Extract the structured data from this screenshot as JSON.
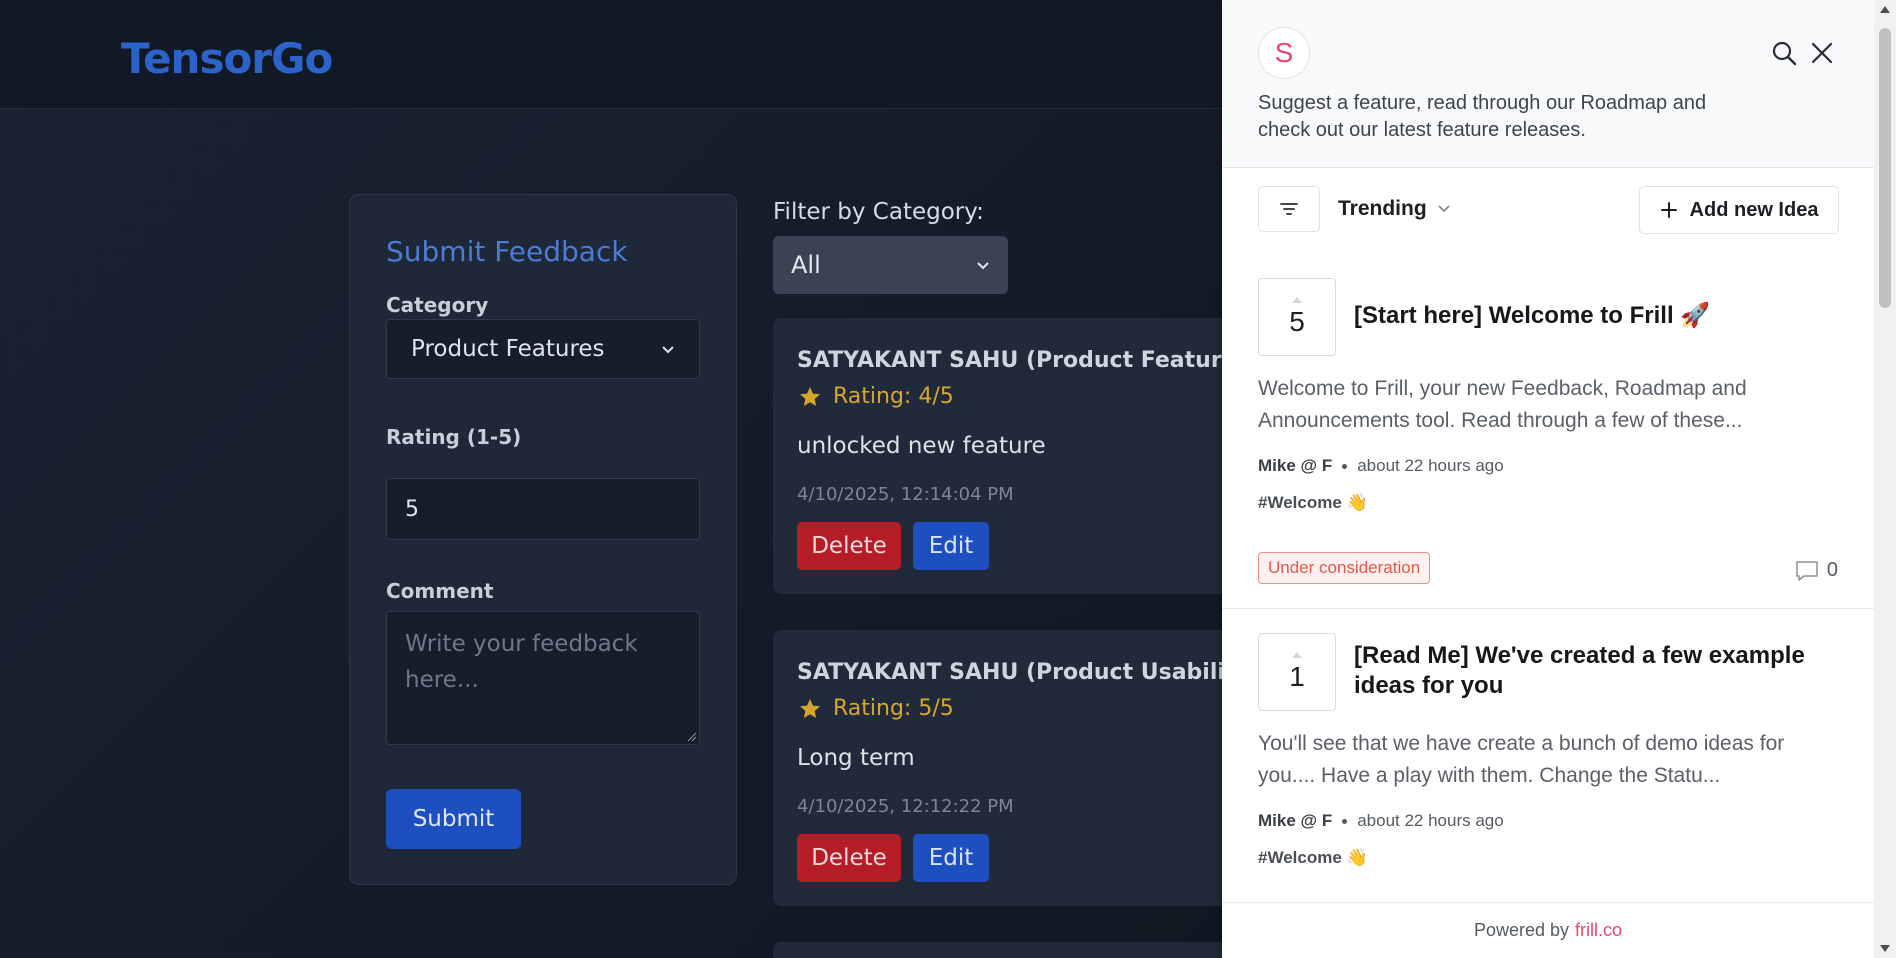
{
  "app": {
    "logo": "TensorGo"
  },
  "form": {
    "title": "Submit Feedback",
    "category_label": "Category",
    "category_value": "Product Features",
    "rating_label": "Rating (1-5)",
    "rating_value": "5",
    "comment_label": "Comment",
    "comment_placeholder": "Write your feedback here...",
    "submit_label": "Submit"
  },
  "filter": {
    "label": "Filter by Category:",
    "value": "All"
  },
  "feedback": [
    {
      "name": "SATYAKANT SAHU (Product Features)",
      "rating": "Rating: 4/5",
      "comment": "unlocked new feature",
      "date": "4/10/2025, 12:14:04 PM",
      "delete_label": "Delete",
      "edit_label": "Edit"
    },
    {
      "name": "SATYAKANT SAHU (Product Usability)",
      "rating": "Rating: 5/5",
      "comment": "Long term",
      "date": "4/10/2025, 12:12:22 PM",
      "delete_label": "Delete",
      "edit_label": "Edit"
    }
  ],
  "frill": {
    "avatar_letter": "S",
    "description": "Suggest a feature, read through our Roadmap and check out our latest feature releases.",
    "sort_label": "Trending",
    "add_idea_label": "Add new Idea",
    "ideas": [
      {
        "votes": "5",
        "title": "[Start here] Welcome to Frill 🚀",
        "body": "Welcome to Frill, your new Feedback, Roadmap and Announcements tool. Read through a few of these...",
        "author": "Mike @ F",
        "time": "about 22 hours ago",
        "tag": "#Welcome 👋",
        "status": "Under consideration",
        "comments": "0"
      },
      {
        "votes": "1",
        "title": "[Read Me] We've created a few example ideas for you",
        "body": "You'll see that we have create a bunch of demo ideas for you.... Have a play with them. Change the Statu...",
        "author": "Mike @ F",
        "time": "about 22 hours ago",
        "tag": "#Welcome 👋"
      }
    ],
    "powered_by": "Powered by",
    "powered_link": "frill.co"
  },
  "icons": {
    "search": "search-icon",
    "close": "close-icon",
    "filter": "filter-icon",
    "plus": "plus-icon",
    "star": "star-icon",
    "comment": "comment-icon"
  },
  "colors": {
    "brand": "#2b63c9",
    "primary_button": "#1e4fc0",
    "danger_button": "#b51c25",
    "rating_star": "#d4a72c",
    "frill_accent": "#e8476a",
    "status_badge": "#e2594a"
  }
}
